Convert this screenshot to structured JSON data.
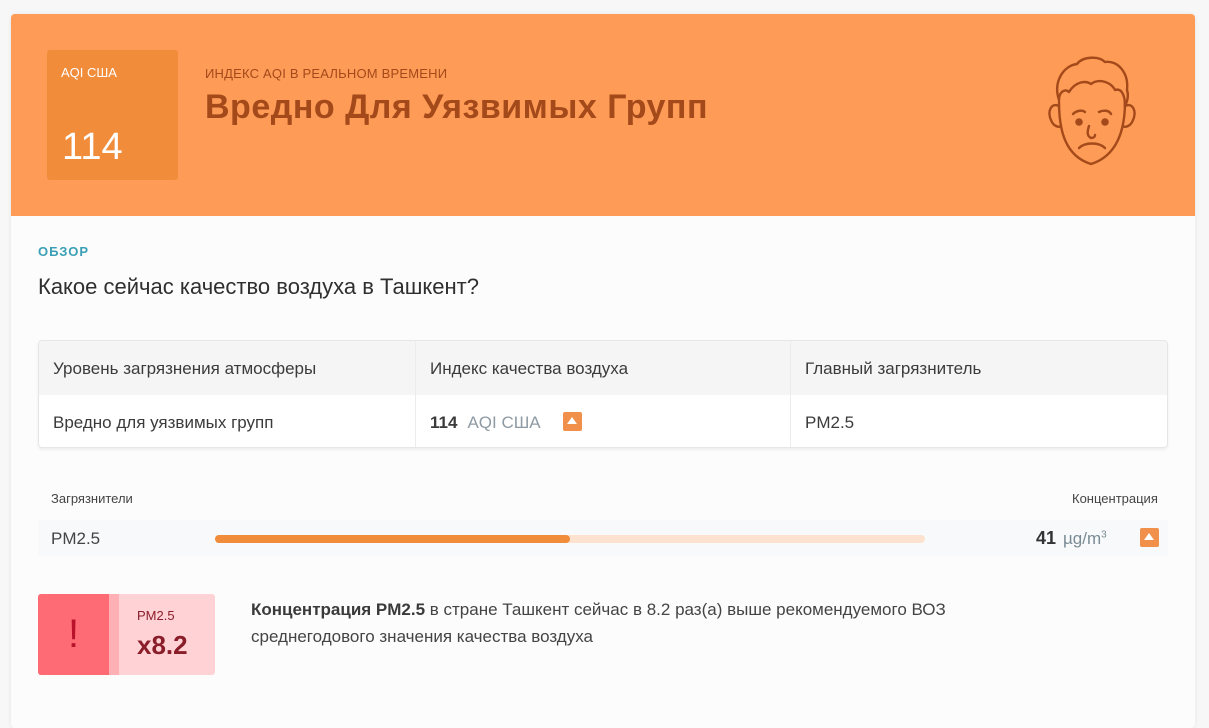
{
  "banner": {
    "box_label": "AQI США",
    "box_value": "114",
    "subtitle": "ИНДЕКС AQI В РЕАЛЬНОМ ВРЕМЕНИ",
    "title": "Вредно Для Уязвимых Групп",
    "face_icon": "sad-face-icon",
    "color": "#fe9b57"
  },
  "overview": {
    "label": "ОБЗОР",
    "question": "Какое сейчас качество воздуха в Ташкент?"
  },
  "table": {
    "headers": [
      "Уровень загрязнения атмосферы",
      "Индекс качества воздуха",
      "Главный загрязнитель"
    ],
    "level": "Вредно для уязвимых групп",
    "aqi_value": "114",
    "aqi_unit": "AQI США",
    "main_pollutant": "PM2.5",
    "trend_icon": "arrow-up-icon"
  },
  "pollutants": {
    "header_left": "Загрязнители",
    "header_right": "Концентрация",
    "rows": [
      {
        "name": "PM2.5",
        "value": "41",
        "unit": "µg/m",
        "unit_sup": "3",
        "bar_fraction": 0.5
      }
    ]
  },
  "who": {
    "pm_label": "PM2.5",
    "multiplier": "x8.2",
    "text_bold": "Концентрация PM2.5",
    "text_rest": " в стране Ташкент сейчас в 8.2 раз(а) выше рекомендуемого ВОЗ среднегодового значения качества воздуха"
  }
}
